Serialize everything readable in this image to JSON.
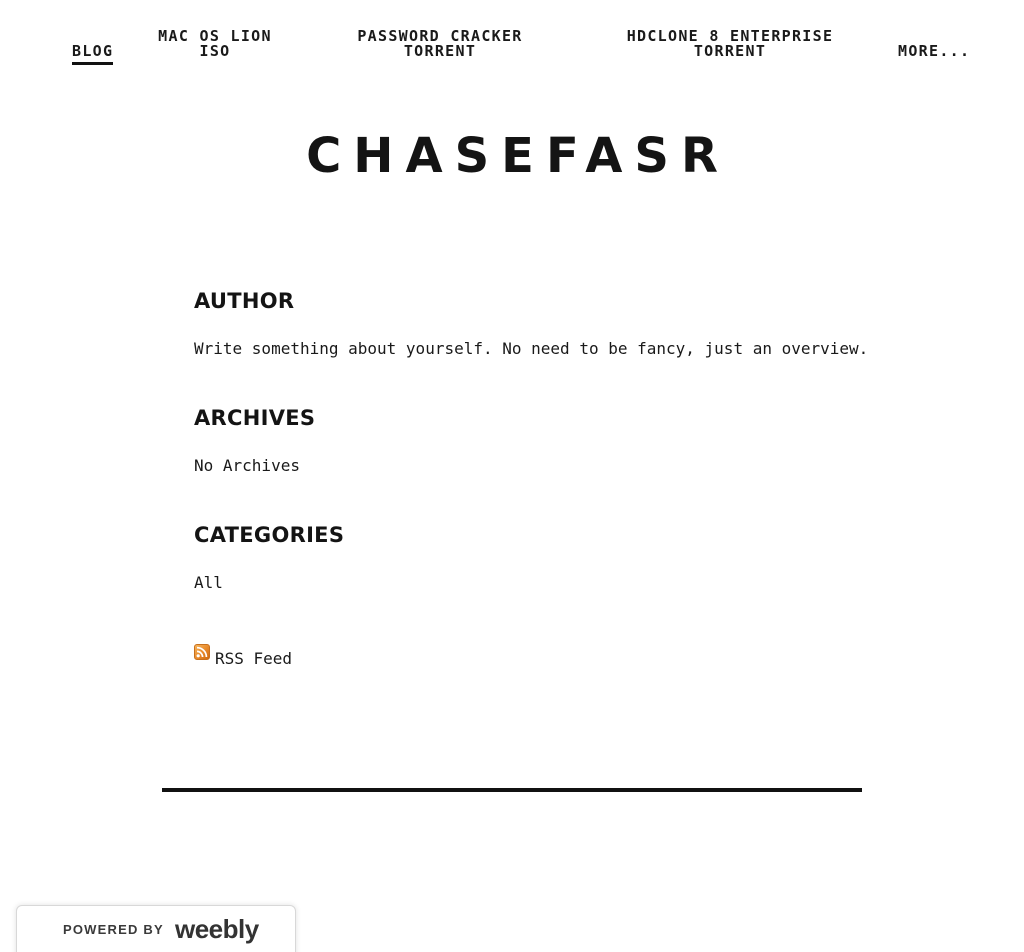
{
  "nav": {
    "items": [
      {
        "label": "Blog",
        "active": true
      },
      {
        "line1": "Mac OS Lion",
        "line2": "ISO"
      },
      {
        "line1": "Password Cracker",
        "line2": "Torrent"
      },
      {
        "line1": "HDClone 8 Enterprise",
        "line2": "Torrent"
      },
      {
        "label": "More..."
      }
    ]
  },
  "header": {
    "site_title": "CHASEFASR"
  },
  "sidebar": {
    "author": {
      "heading": "AUTHOR",
      "text": "Write something about yourself. No need to be fancy, just an overview."
    },
    "archives": {
      "heading": "ARCHIVES",
      "text": "No Archives"
    },
    "categories": {
      "heading": "CATEGORIES",
      "items": [
        "All"
      ]
    },
    "rss": {
      "label": "RSS Feed",
      "icon": "rss-icon"
    }
  },
  "footer_badge": {
    "powered_by": "POWERED BY",
    "brand": "weebly"
  },
  "colors": {
    "text": "#111111",
    "background": "#ffffff",
    "rss_orange": "#e8892a"
  }
}
